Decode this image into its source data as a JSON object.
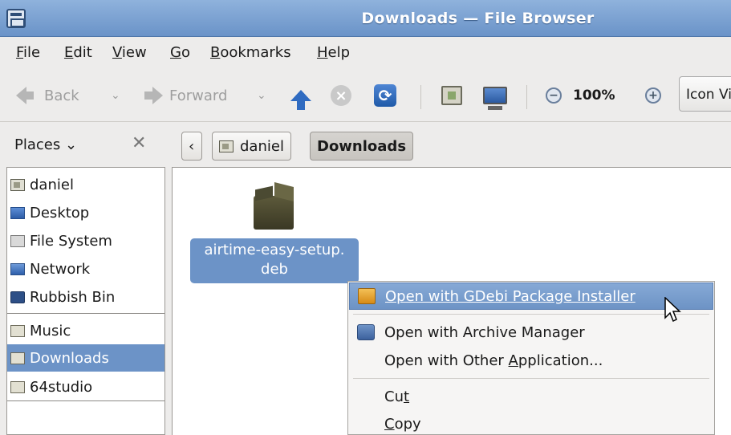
{
  "window": {
    "title": "Downloads — File Browser"
  },
  "menubar": [
    {
      "label": "File",
      "mnemonic": "F",
      "rest": "ile"
    },
    {
      "label": "Edit",
      "mnemonic": "E",
      "rest": "dit"
    },
    {
      "label": "View",
      "mnemonic": "V",
      "rest": "iew"
    },
    {
      "label": "Go",
      "mnemonic": "G",
      "rest": "o"
    },
    {
      "label": "Bookmarks",
      "mnemonic": "B",
      "rest": "ookmarks"
    },
    {
      "label": "Help",
      "mnemonic": "H",
      "rest": "elp"
    }
  ],
  "toolbar": {
    "back_label": "Back",
    "forward_label": "Forward",
    "zoom_level": "100%",
    "view_mode": "Icon View",
    "stop_glyph": "×",
    "reload_glyph": "⟳",
    "zoom_out_glyph": "−",
    "zoom_in_glyph": "+",
    "dropdown_glyph": "⌄",
    "icons": [
      "back-arrow-icon",
      "forward-arrow-icon",
      "up-arrow-icon",
      "stop-icon",
      "reload-icon",
      "home-folder-icon",
      "computer-icon",
      "zoom-out-icon",
      "zoom-in-icon"
    ]
  },
  "pathbar": {
    "places_label": "Places",
    "places_chevron": "⌄",
    "close_glyph": "✕",
    "back_glyph": "‹",
    "crumbs": [
      "daniel",
      "Downloads"
    ]
  },
  "sidebar": {
    "items": [
      {
        "label": "daniel",
        "icon": "home-folder-icon"
      },
      {
        "label": "Desktop",
        "icon": "desktop-icon"
      },
      {
        "label": "File System",
        "icon": "drive-icon"
      },
      {
        "label": "Network",
        "icon": "network-icon"
      },
      {
        "label": "Rubbish Bin",
        "icon": "trash-icon"
      }
    ],
    "bookmarks": [
      {
        "label": "Music",
        "icon": "folder-icon",
        "selected": false
      },
      {
        "label": "Downloads",
        "icon": "folder-icon",
        "selected": true
      },
      {
        "label": "64studio",
        "icon": "folder-icon",
        "selected": false
      }
    ]
  },
  "content": {
    "file": {
      "name_line1": "airtime-easy-setup.",
      "name_line2": "deb",
      "icon": "package-icon"
    }
  },
  "context_menu": {
    "items": [
      {
        "before": "Open with GDebi Package Installer",
        "mnemonic": "",
        "after": "",
        "icon": "gdebi-icon",
        "highlighted": true
      },
      {
        "before": "Open with Archive Manager",
        "mnemonic": "",
        "after": "",
        "icon": "archive-manager-icon",
        "highlighted": false
      },
      {
        "before": "Open with Other ",
        "mnemonic": "A",
        "after": "pplication...",
        "icon": "",
        "highlighted": false
      },
      {
        "before": "Cu",
        "mnemonic": "t",
        "after": "",
        "icon": "",
        "highlighted": false
      },
      {
        "before": "",
        "mnemonic": "C",
        "after": "opy",
        "icon": "",
        "highlighted": false
      }
    ]
  },
  "colors": {
    "titlebar": "#6a93c8",
    "selection": "#6c93c7",
    "menu_highlight": "#7a9fd0"
  }
}
